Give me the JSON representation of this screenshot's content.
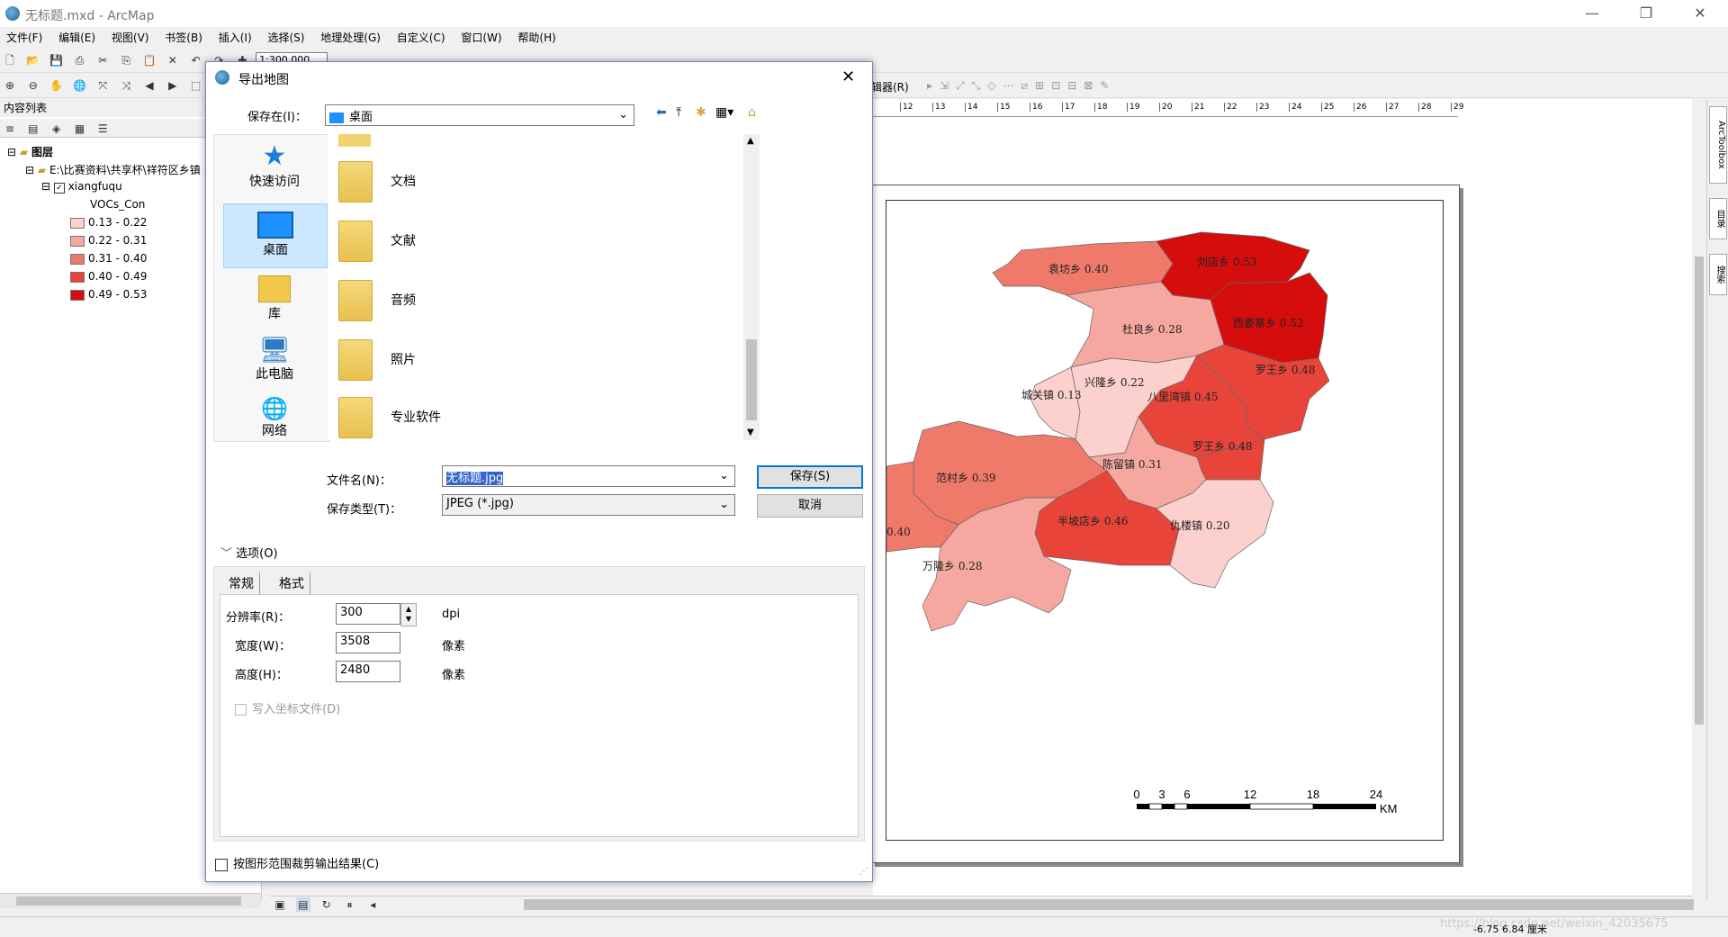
{
  "window": {
    "title": "无标题.mxd - ArcMap",
    "controls": {
      "minimize": "—",
      "maximize": "❐",
      "close": "✕"
    }
  },
  "menubar": [
    "文件(F)",
    "编辑(E)",
    "视图(V)",
    "书签(B)",
    "插入(I)",
    "选择(S)",
    "地理处理(G)",
    "自定义(C)",
    "窗口(W)",
    "帮助(H)"
  ],
  "toolbar": {
    "scale": "1:300,000",
    "editor_label": "辑器(R)"
  },
  "toc": {
    "title": "内容列表",
    "layers_label": "图层",
    "path": "E:\\比赛资料\\共享杯\\祥符区乡镇",
    "layer_name": "xiangfuqu",
    "field_name": "VOCs_Con",
    "legend": [
      {
        "label": "0.13 - 0.22",
        "color": "#fcd0cc"
      },
      {
        "label": "0.22 - 0.31",
        "color": "#f6a8a0"
      },
      {
        "label": "0.31 - 0.40",
        "color": "#ef7a6a"
      },
      {
        "label": "0.40 - 0.49",
        "color": "#e8443a"
      },
      {
        "label": "0.49 - 0.53",
        "color": "#d60d0d"
      }
    ]
  },
  "map": {
    "towns": [
      {
        "name": "袁坊乡 0.40",
        "color": "#ef7a6a"
      },
      {
        "name": "刘店乡 0.53",
        "color": "#d60d0d"
      },
      {
        "name": "杜良乡 0.28",
        "color": "#f6a8a0"
      },
      {
        "name": "西姜寨乡 0.52",
        "color": "#d60d0d"
      },
      {
        "name": "罗王乡 0.48",
        "color": "#e8443a"
      },
      {
        "name": "兴隆乡 0.22",
        "color": "#fcd0cc"
      },
      {
        "name": "城关镇 0.13",
        "color": "#fcd0cc"
      },
      {
        "name": "八里湾镇 0.45",
        "color": "#e8443a"
      },
      {
        "name": "罗王乡 0.48",
        "color": "#e8443a"
      },
      {
        "name": "范村乡 0.39",
        "color": "#ef7a6a"
      },
      {
        "name": "陈留镇 0.31",
        "color": "#f6a8a0"
      },
      {
        "name": "半坡店乡 0.46",
        "color": "#e8443a"
      },
      {
        "name": "仇楼镇 0.20",
        "color": "#fcd0cc"
      },
      {
        "name": "万隆乡 0.28",
        "color": "#f6a8a0"
      },
      {
        "name": "0.40",
        "color": "#ef7a6a"
      }
    ],
    "scalebar": {
      "ticks": [
        "0",
        "3",
        "6",
        "12",
        "18",
        "24"
      ],
      "unit": "KM"
    },
    "ruler_ticks": [
      "12",
      "13",
      "14",
      "15",
      "16",
      "17",
      "18",
      "19",
      "20",
      "21",
      "22",
      "23",
      "24",
      "25",
      "26",
      "27",
      "28",
      "29"
    ]
  },
  "dialog": {
    "title": "导出地图",
    "save_in_label": "保存在(I)：",
    "save_in_value": "桌面",
    "places": [
      {
        "label": "快速访问",
        "icon": "star-icon"
      },
      {
        "label": "桌面",
        "icon": "desktop-icon"
      },
      {
        "label": "库",
        "icon": "library-icon"
      },
      {
        "label": "此电脑",
        "icon": "computer-icon"
      },
      {
        "label": "网络",
        "icon": "network-icon"
      }
    ],
    "files": [
      {
        "name": "文档"
      },
      {
        "name": "文献"
      },
      {
        "name": "音频"
      },
      {
        "name": "照片"
      },
      {
        "name": "专业软件"
      }
    ],
    "filename_label": "文件名(N)：",
    "filename_value": "无标题.jpg",
    "filetype_label": "保存类型(T)：",
    "filetype_value": "JPEG (*.jpg)",
    "save_button": "保存(S)",
    "cancel_button": "取消",
    "options_label": "选项(O)",
    "tabs": [
      "常规",
      "格式"
    ],
    "resolution_label": "分辨率(R)：",
    "resolution_value": "300",
    "resolution_unit": "dpi",
    "width_label": "宽度(W)：",
    "width_value": "3508",
    "width_unit": "像素",
    "height_label": "高度(H)：",
    "height_value": "2480",
    "height_unit": "像素",
    "world_file_label": "写入坐标文件(D)",
    "clip_label": "按图形范围裁剪输出结果(C)"
  },
  "right_tabs": [
    "ArcToolbox",
    "目录",
    "搜索"
  ],
  "status": {
    "coords": "-6.75  6.84 厘米",
    "watermark": "https://blog.csdn.net/weixin_42035675"
  }
}
